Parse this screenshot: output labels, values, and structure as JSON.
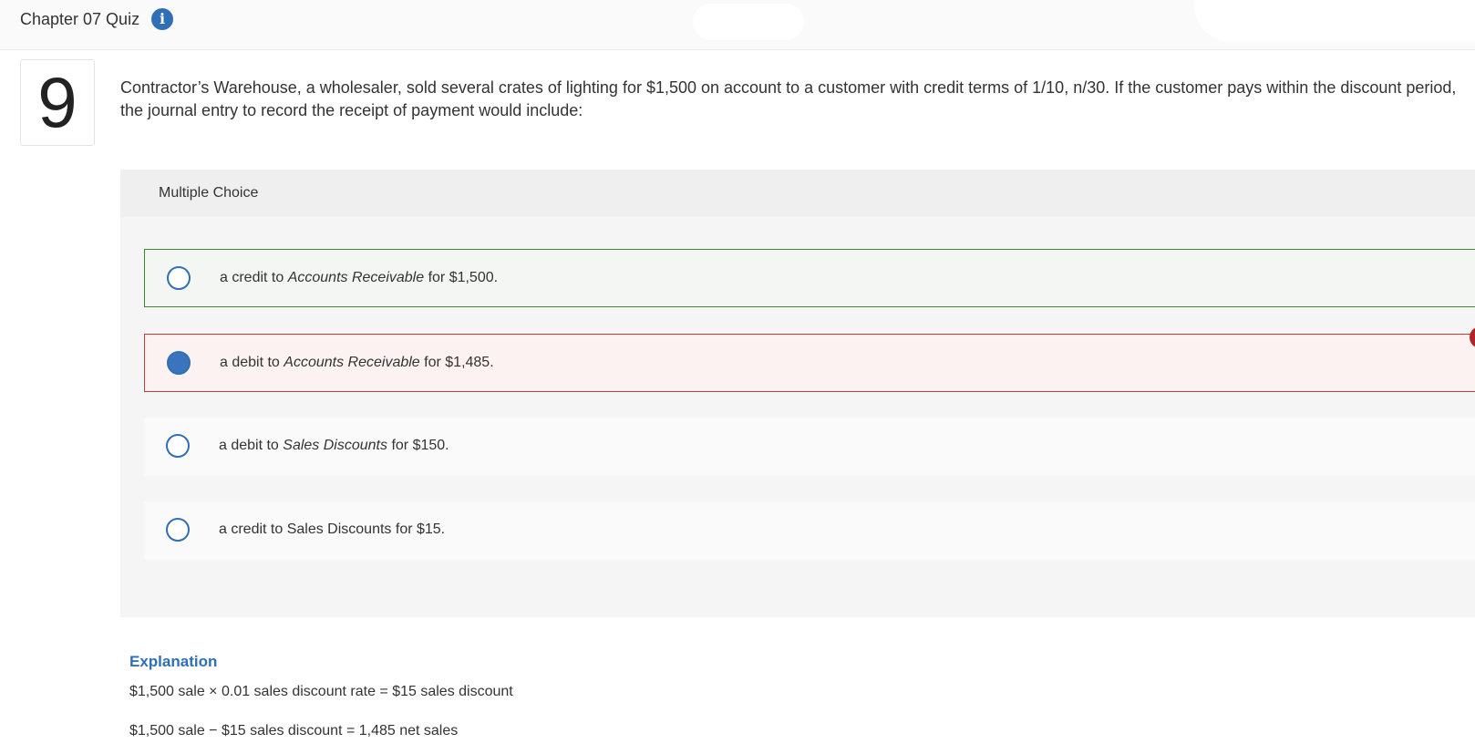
{
  "header": {
    "title": "Chapter 07 Quiz",
    "info_icon": "info-icon"
  },
  "question": {
    "number": "9",
    "text": "Contractor’s Warehouse, a wholesaler, sold several crates of lighting for $1,500 on account to a customer with credit terms of 1/10, n/30. If the customer pays within the discount period, the journal entry to record the receipt of payment would include:"
  },
  "multiple_choice": {
    "label": "Multiple Choice",
    "choices": [
      {
        "prefix": "a credit to ",
        "account": "Accounts Receivable",
        "suffix": " for $1,500.",
        "state": "correct",
        "selected": false
      },
      {
        "prefix": "a debit to ",
        "account": "Accounts Receivable",
        "suffix": " for $1,485.",
        "state": "incorrect",
        "selected": true
      },
      {
        "prefix": "a debit to ",
        "account": "Sales Discounts",
        "suffix": " for $150.",
        "state": "neutral",
        "selected": false
      },
      {
        "prefix": "a credit to Sales Discounts for $15.",
        "account": "",
        "suffix": "",
        "state": "neutral",
        "selected": false
      }
    ]
  },
  "explanation": {
    "title": "Explanation",
    "lines": [
      "$1,500 sale × 0.01 sales discount rate = $15 sales discount",
      "$1,500 sale − $15 sales discount = 1,485 net sales"
    ]
  },
  "colors": {
    "accent": "#2f6fb5",
    "correct_border": "#3b8a2a",
    "incorrect_border": "#c23a3a"
  }
}
